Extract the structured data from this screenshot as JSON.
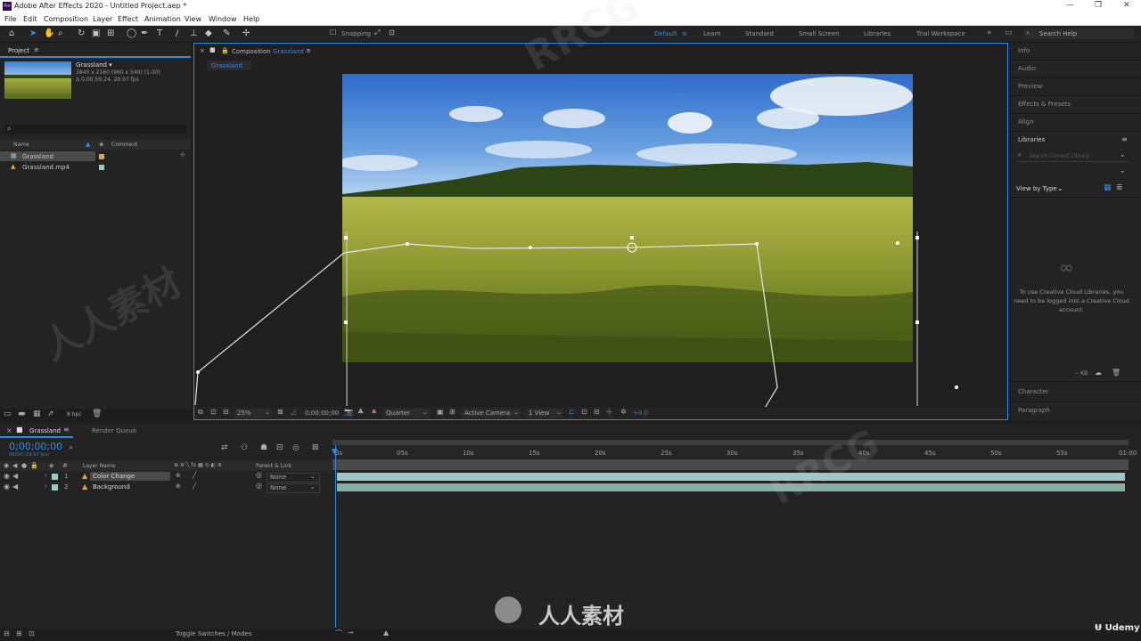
{
  "window": {
    "title": "Adobe After Effects 2020 - Untitled Project.aep *",
    "app_icon": "Ae"
  },
  "menu": [
    "File",
    "Edit",
    "Composition",
    "Layer",
    "Effect",
    "Animation",
    "View",
    "Window",
    "Help"
  ],
  "toolbar": {
    "snapping_label": "Snapping",
    "workspaces": [
      "Default",
      "Learn",
      "Standard",
      "Small Screen",
      "Libraries",
      "Trial Workspace"
    ],
    "active_workspace": "Default",
    "search_placeholder": "Search Help"
  },
  "project": {
    "tab_label": "Project",
    "selected_name": "Grassland ▾",
    "selected_info1": "3840 x 2160  (960 x 540) (1.00)",
    "selected_info2": "Δ 0;00;59;24, 29.97 fps",
    "search_icon": "⌕",
    "col_name": "Name",
    "col_comment": "Comment",
    "items": [
      {
        "name": "Grassland",
        "type": "composition"
      },
      {
        "name": "Grassland.mp4",
        "type": "footage"
      }
    ],
    "bpc_label": "8 bpc"
  },
  "composition": {
    "tab_label": "Composition",
    "comp_name": "Grassland",
    "breadcrumb": "Grassland",
    "zoom": "25%",
    "timecode": "0;00;00;00",
    "resolution": "Quarter",
    "camera": "Active Camera",
    "views": "1 View",
    "exposure": "+0.0"
  },
  "right_panels": {
    "tabs": [
      "Info",
      "Audio",
      "Preview",
      "Effects & Presets",
      "Align",
      "Libraries"
    ],
    "libraries_search_placeholder": "Search Current Library",
    "view_by": "View by Type",
    "cc_message": "To use Creative Cloud Libraries, you need to be logged into a Creative Cloud account.",
    "bottom_tabs": [
      "Character",
      "Paragraph"
    ],
    "kb_label": "-- KB"
  },
  "timeline": {
    "comp_tab": "Grassland",
    "render_queue_tab": "Render Queue",
    "timecode": "0;00;00;00",
    "frame_info": "00000 (29.97 fps)",
    "col_layer_name": "Layer Name",
    "col_parent": "Parent & Link",
    "ruler_labels": [
      "0s",
      "05s",
      "10s",
      "15s",
      "20s",
      "25s",
      "30s",
      "35s",
      "40s",
      "45s",
      "50s",
      "55s",
      "01:00"
    ],
    "layers": [
      {
        "num": "1",
        "name": "Color Change",
        "parent": "None",
        "color": "#9ec7c0"
      },
      {
        "num": "2",
        "name": "Background",
        "parent": "None",
        "color": "#9ec7c0"
      }
    ],
    "toggle_label": "Toggle Switches / Modes"
  },
  "watermarks": [
    "RRCG",
    "人人素材",
    "人人素材",
    "Udemy"
  ],
  "colors": {
    "accent": "#2d8ceb",
    "track_bar": "#9ec7c0",
    "panel_bg": "#232323"
  }
}
